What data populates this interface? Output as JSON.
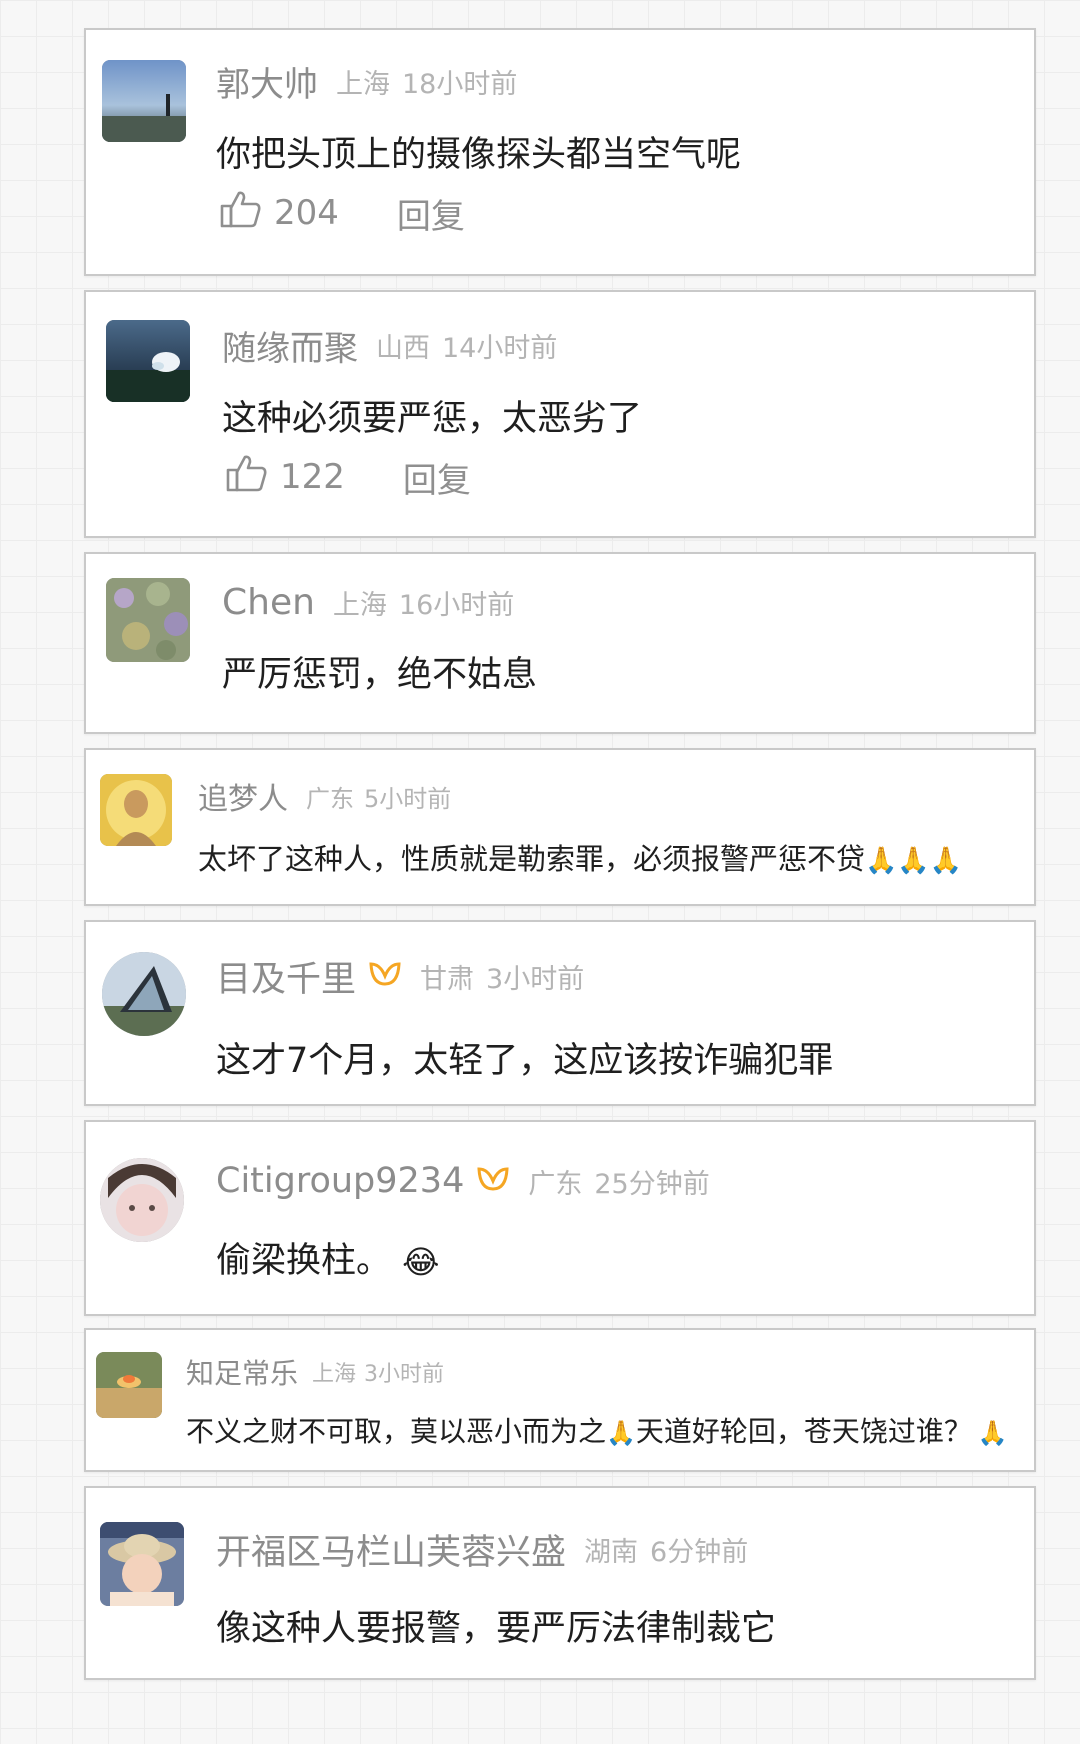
{
  "comments": [
    {
      "user": "郭大帅",
      "location": "上海",
      "time": "18小时前",
      "text": "你把头顶上的摄像探头都当空气呢",
      "likes": "204",
      "reply": "回复"
    },
    {
      "user": "随缘而聚",
      "location": "山西",
      "time": "14小时前",
      "text": "这种必须要严惩，太恶劣了",
      "likes": "122",
      "reply": "回复"
    },
    {
      "user": "Chen",
      "location": "上海",
      "time": "16小时前",
      "text": "严厉惩罚，绝不姑息"
    },
    {
      "user": "追梦人",
      "location": "广东",
      "time": "5小时前",
      "text": "太坏了这种人，性质就是勒索罪，必须报警严惩不贷",
      "emoji": "🙏🙏🙏"
    },
    {
      "user": "目及千里",
      "location": "甘肃",
      "time": "3小时前",
      "text": "这才7个月，太轻了，这应该按诈骗犯罪",
      "vip": true
    },
    {
      "user": "Citigroup9234",
      "location": "广东",
      "time": "25分钟前",
      "text": "偷梁换柱。",
      "emoji": "😂",
      "vip": true
    },
    {
      "user": "知足常乐",
      "location": "上海",
      "time": "3小时前",
      "text_a": "不义之财不可取，莫以恶小而为之",
      "text_b": "天道好轮回，苍天饶过谁？",
      "emoji": "🙏"
    },
    {
      "user": "开福区马栏山芙蓉兴盛",
      "location": "湖南",
      "time": "6分钟前",
      "text": "像这种人要报警，要严厉法律制裁它"
    }
  ],
  "colors": {
    "vip": "#f5a623",
    "username": "#8c8c8c",
    "meta": "#b4b4b4",
    "text": "#1f1f1f"
  }
}
